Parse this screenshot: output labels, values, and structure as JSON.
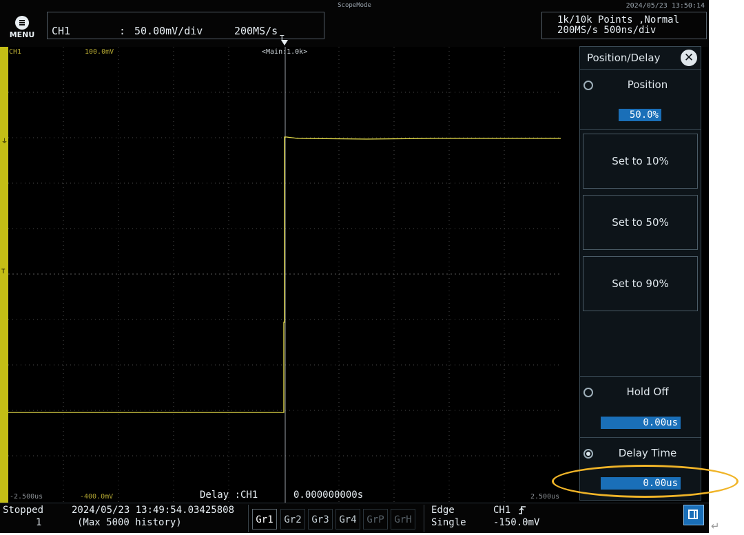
{
  "header": {
    "mode_title": "ScopeMode",
    "datetime": "2024/05/23 13:50:14",
    "menu_label": "MENU",
    "channel": "CH1",
    "colon": ":",
    "vdiv": "50.00mV/div",
    "sample_rate": "200MS/s",
    "acq_line1": "1k/10k Points  ,Normal",
    "acq_line2": "200MS/s   500ns/div"
  },
  "grid": {
    "channel_label": "CH1",
    "scale_label": "100.0mV",
    "main_label": "<Main:1.0k>",
    "trigger_marker": "T",
    "left_time": "-2.500us",
    "bottom_voltage": "-400.0mV",
    "right_time": "2.500us",
    "delay_label": "Delay :CH1",
    "delay_value": "0.000000000s"
  },
  "panel": {
    "title": "Position/Delay",
    "position_label": "Position",
    "position_value": "50.0%",
    "set10": "Set to 10%",
    "set50": "Set to 50%",
    "set90": "Set to 90%",
    "holdoff_label": "Hold Off",
    "holdoff_value": "0.00us",
    "delay_time_label": "Delay Time",
    "delay_time_value": "0.00us"
  },
  "footer": {
    "status": "Stopped",
    "history_index": "1",
    "timestamp": "2024/05/23 13:49:54.03425808",
    "history_note": "(Max 5000 history)",
    "groups": [
      "Gr1",
      "Gr2",
      "Gr3",
      "Gr4",
      "GrP",
      "GrH"
    ],
    "trigger_type": "Edge",
    "trigger_mode": "Single",
    "trigger_source": "CH1",
    "trigger_level": "-150.0mV"
  },
  "colors": {
    "trace": "#e9e04a",
    "accent": "#1a6fb8",
    "highlight": "#f0b428"
  }
}
